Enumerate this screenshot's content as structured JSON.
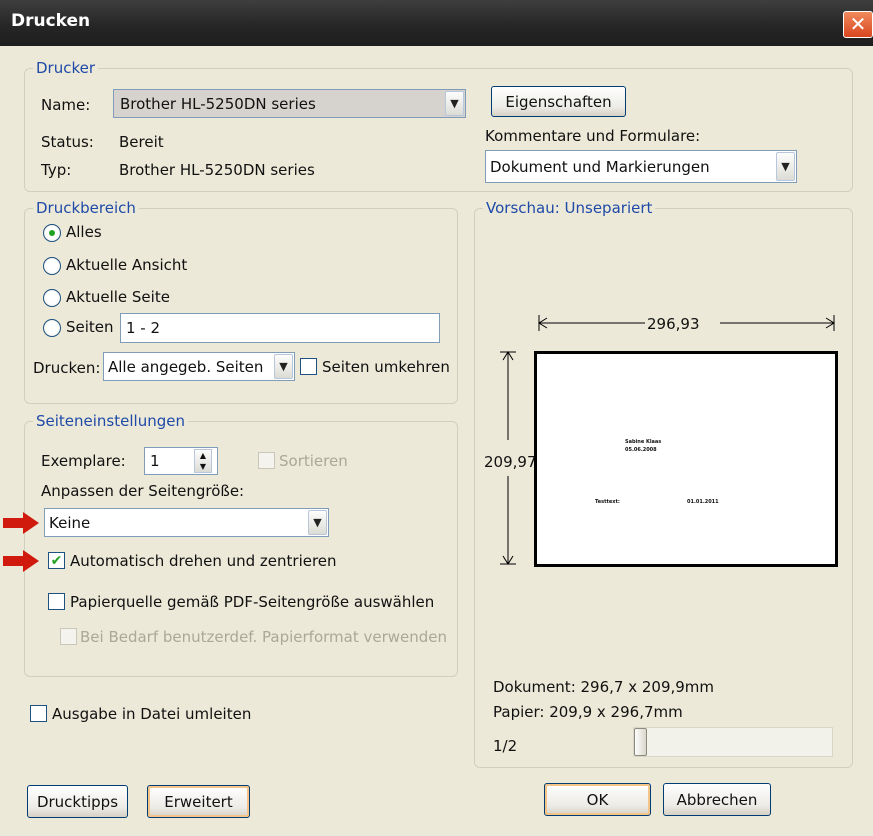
{
  "window": {
    "title": "Drucken",
    "close_glyph": "✕"
  },
  "printer": {
    "legend": "Drucker",
    "name_label": "Name:",
    "name_value": "Brother HL-5250DN series",
    "status_label": "Status:",
    "status_value": "Bereit",
    "type_label": "Typ:",
    "type_value": "Brother HL-5250DN series",
    "properties_button": "Eigenschaften",
    "comments_label": "Kommentare und Formulare:",
    "comments_value": "Dokument und Markierungen"
  },
  "print_range": {
    "legend": "Druckbereich",
    "options": [
      {
        "label": "Alles",
        "selected": true
      },
      {
        "label": "Aktuelle Ansicht",
        "selected": false
      },
      {
        "label": "Aktuelle Seite",
        "selected": false
      },
      {
        "label": "Seiten",
        "selected": false
      }
    ],
    "pages_value": "1 - 2",
    "print_label": "Drucken:",
    "print_value": "Alle angegeb. Seiten",
    "reverse_label": "Seiten umkehren",
    "reverse_checked": false
  },
  "page_setup": {
    "legend": "Seiteneinstellungen",
    "copies_label": "Exemplare:",
    "copies_value": "1",
    "collate_label": "Sortieren",
    "fit_label": "Anpassen der Seitengröße:",
    "fit_value": "Keine",
    "autorotate_label": "Automatisch drehen und zentrieren",
    "autorotate_checked": true,
    "paper_source_label": "Papierquelle gemäß PDF-Seitengröße auswählen",
    "paper_source_checked": false,
    "custom_paper_label": "Bei Bedarf benutzerdef. Papierformat verwenden"
  },
  "output_to_file": {
    "label": "Ausgabe in Datei umleiten",
    "checked": false
  },
  "preview": {
    "legend": "Vorschau: Unsepariert",
    "width_dim": "296,93",
    "height_dim": "209,97",
    "page_text_name": "Sabine Klaas",
    "page_text_date1": "05.06.2008",
    "page_text_left": "Testtext:",
    "page_text_right": "01.01.2011",
    "document_info": "Dokument: 296,7 x 209,9mm",
    "paper_info": "Papier: 209,9 x 296,7mm",
    "page_counter": "1/2",
    "slider_position": 0
  },
  "buttons": {
    "tips": "Drucktipps",
    "advanced": "Erweitert",
    "ok": "OK",
    "cancel": "Abbrechen"
  },
  "colors": {
    "legend_blue": "#1f4aa8",
    "check_green": "#21a121",
    "arrow_red": "#d01a0e"
  }
}
